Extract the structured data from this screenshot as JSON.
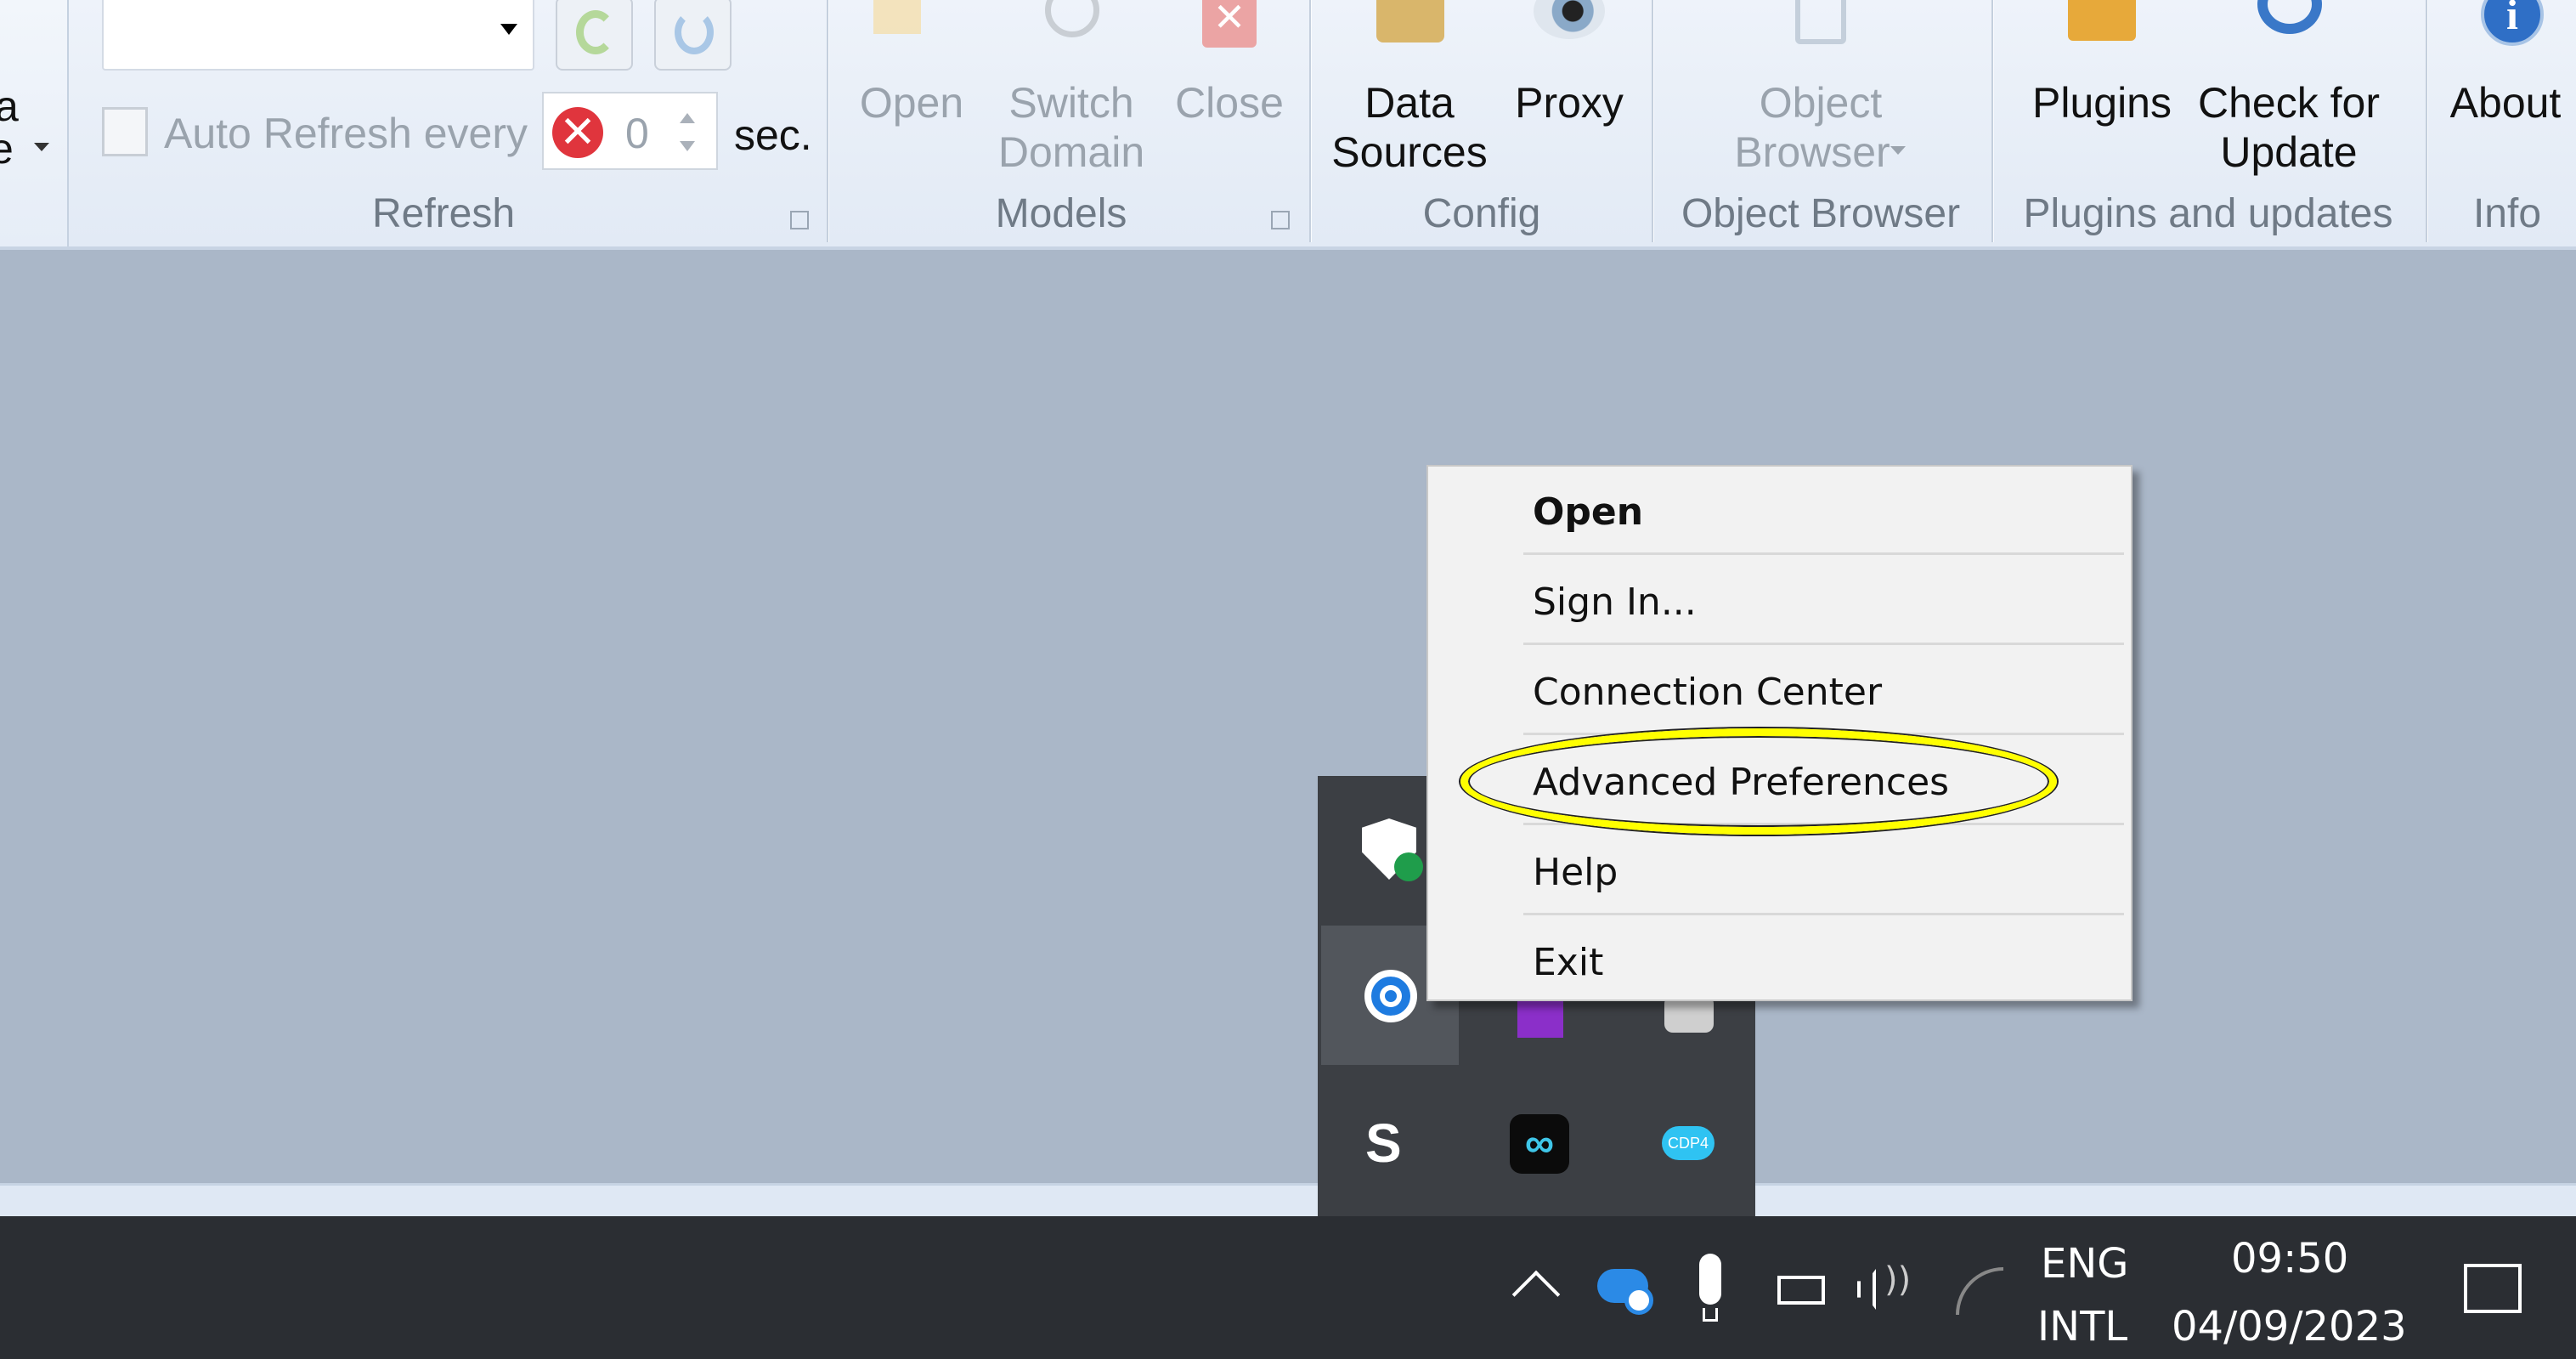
{
  "ribbon": {
    "left_pane": {
      "line1": "a",
      "line2": "e"
    },
    "refresh": {
      "dropdown_value": "",
      "auto_refresh_label": "Auto Refresh every",
      "auto_refresh_checked": false,
      "interval_value": "0",
      "interval_unit": "sec.",
      "group_label": "Refresh"
    },
    "models": {
      "open_label": "Open",
      "switch_label_1": "Switch",
      "switch_label_2": "Domain",
      "close_label": "Close",
      "group_label": "Models"
    },
    "config": {
      "data_sources_1": "Data",
      "data_sources_2": "Sources",
      "proxy_label": "Proxy",
      "group_label": "Config"
    },
    "object_browser": {
      "button_1": "Object",
      "button_2": "Browser",
      "group_label": "Object Browser"
    },
    "plugins": {
      "plugins_label": "Plugins",
      "check_1": "Check for",
      "check_2": "Update",
      "group_label": "Plugins and updates"
    },
    "info": {
      "about_label": "About",
      "group_label": "Info"
    }
  },
  "context_menu": {
    "items": [
      {
        "label": "Open",
        "bold": true
      },
      {
        "label": "Sign In..."
      },
      {
        "label": "Connection Center"
      },
      {
        "label": "Advanced Preferences",
        "highlighted_annotation": true
      },
      {
        "label": "Help"
      },
      {
        "label": "Exit"
      }
    ],
    "annotation_color": "#ffff00"
  },
  "tray_overflow": {
    "icons": [
      "windows-security-icon",
      "",
      "",
      "citrix-workspace-icon",
      "onenote-icon",
      "snipping-icon",
      "sophos-icon",
      "webex-icon",
      "cdp-icon"
    ]
  },
  "taskbar": {
    "language_1": "ENG",
    "language_2": "INTL",
    "time": "09:50",
    "date": "04/09/2023"
  },
  "colors": {
    "taskbar": "#2b2e33",
    "desktop": "#aab7c8",
    "menu": "#f2f2f2"
  }
}
